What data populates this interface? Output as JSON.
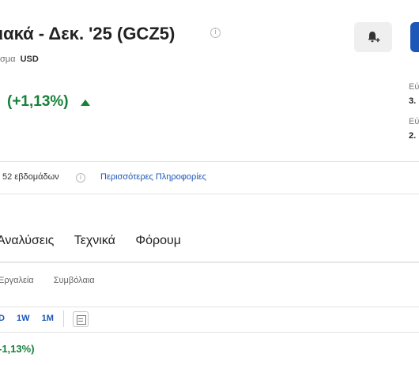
{
  "header": {
    "title": "ιακά - Δεκ. '25 (GCZ5)",
    "info_glyph": "i",
    "currency_label": "σμα",
    "currency_value": "USD"
  },
  "actions": {
    "alert_icon": "bell-plus-icon"
  },
  "quote": {
    "change_text": "(+1,13%)",
    "direction": "up",
    "color": "#168139"
  },
  "side_stats": [
    {
      "label": "Εύ",
      "value": "3."
    },
    {
      "label": "Εύ",
      "value": "2."
    }
  ],
  "range_row": {
    "weeks_text": "52 εβδομάδων",
    "info_glyph": "i",
    "more_info_link": "Περισσότερες Πληροφορίες"
  },
  "tabs": [
    "Αναλύσεις",
    "Τεχνικά",
    "Φόρουμ"
  ],
  "subtabs": [
    "Εργαλεία",
    "Συμβόλαια"
  ],
  "periods": [
    "D",
    "1W",
    "1M"
  ],
  "chart_type_icon": "chart-type-icon",
  "bottom_change": "-1,13%)",
  "colors": {
    "accent": "#1d57b8",
    "positive": "#168139"
  }
}
